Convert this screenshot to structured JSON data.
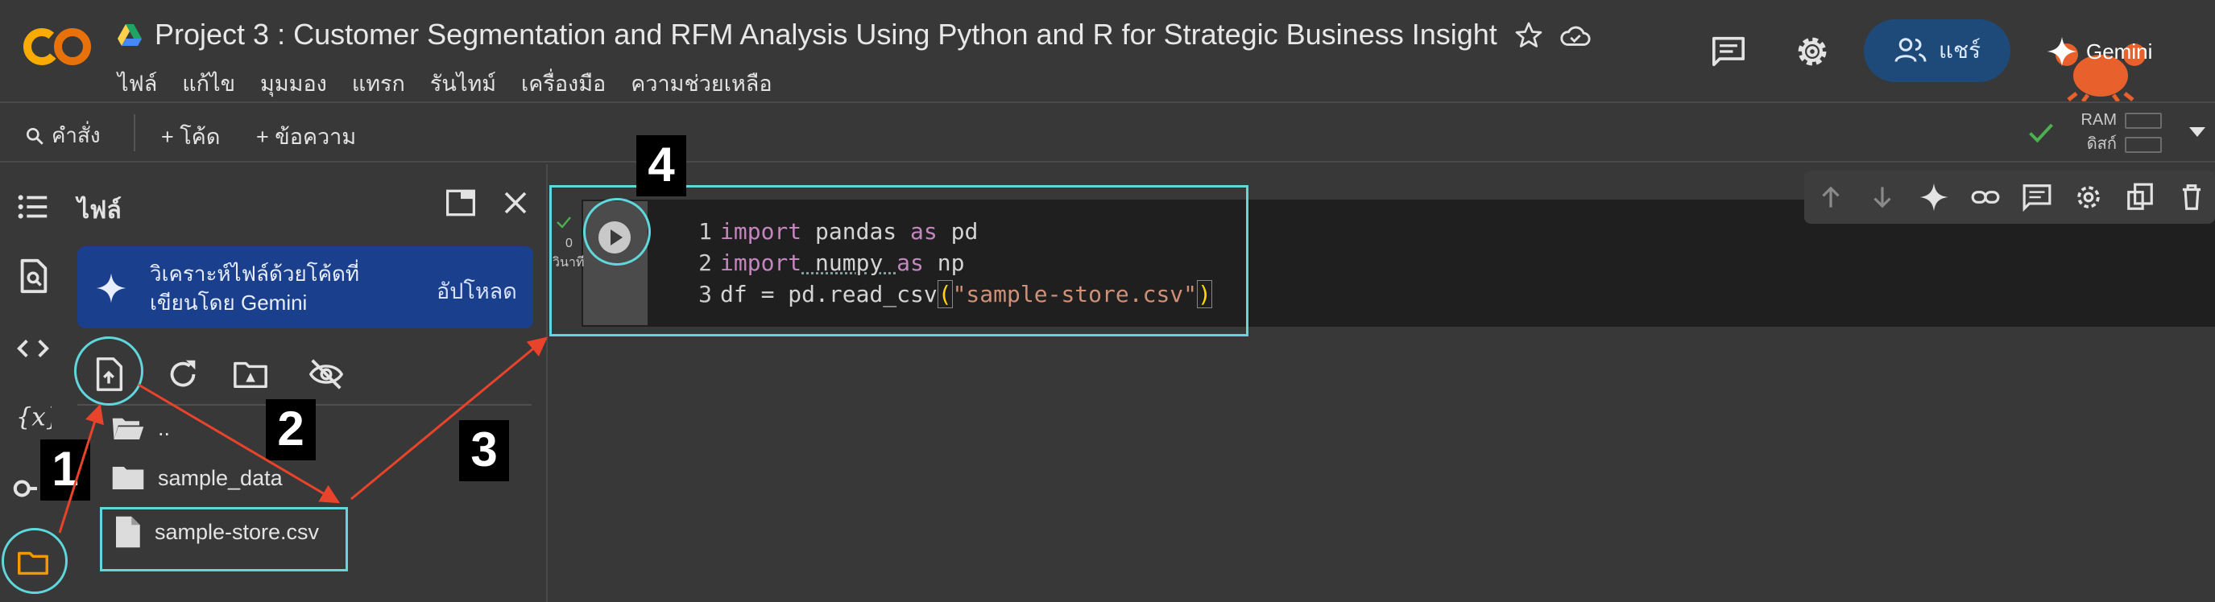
{
  "header": {
    "logo_text": "CO",
    "title": "Project 3 : Customer Segmentation and RFM Analysis Using Python and R  for Strategic Business Insight",
    "menu": [
      "ไฟล์",
      "แก้ไข",
      "มุมมอง",
      "แทรก",
      "รันไทม์",
      "เครื่องมือ",
      "ความช่วยเหลือ"
    ],
    "share_label": "แชร์",
    "gemini_label": "Gemini"
  },
  "toolbar": {
    "command_label": "คำสั่ง",
    "add_code_label": "+ โค้ด",
    "add_text_label": "+ ข้อความ",
    "ram_label": "RAM",
    "disk_label": "ดิสก์"
  },
  "files_panel": {
    "title": "ไฟล์",
    "gemini_card_text": "วิเคราะห์ไฟล์ด้วยโค้ดที่เขียนโดย Gemini",
    "upload_label": "อัปโหลด",
    "items": [
      {
        "name": "..",
        "icon": "folder-open-icon"
      },
      {
        "name": "sample_data",
        "icon": "folder-icon"
      },
      {
        "name": "sample-store.csv",
        "icon": "file-icon"
      }
    ]
  },
  "cell": {
    "exec_count": "0",
    "exec_time": "วินาที",
    "lines": [
      {
        "num": "1",
        "kw1": "import",
        "mod": " pandas ",
        "kw2": "as",
        "alias": " pd"
      },
      {
        "num": "2",
        "kw1": "import",
        "mod": " numpy ",
        "kw2": "as",
        "alias": " np"
      },
      {
        "num": "3",
        "pre": "df = pd.read_csv",
        "lparen": "(",
        "str": "\"sample-store.csv\"",
        "rparen": ")"
      }
    ]
  },
  "annotations": {
    "step1": "1",
    "step2": "2",
    "step3": "3",
    "step4": "4",
    "box_color": "#5fd7dc",
    "arrow_color": "#e8432b"
  },
  "colors": {
    "background": "#383838",
    "share_bg": "#1e4a7a",
    "gemini_card_bg": "#1a3f8c",
    "logo_orange": "#f9ab00",
    "keyword": "#c586c0",
    "string": "#ce9178"
  }
}
